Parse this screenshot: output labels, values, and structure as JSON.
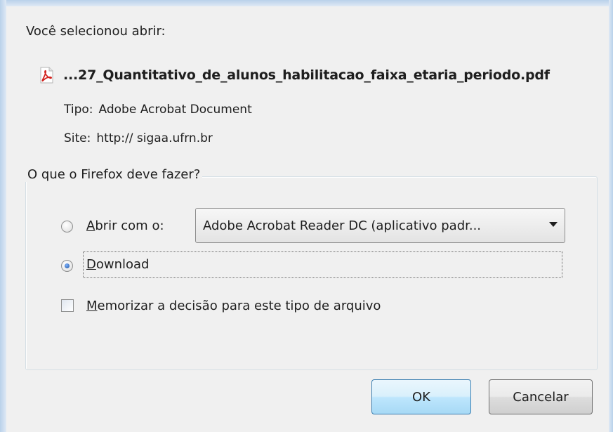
{
  "dialog": {
    "intro": "Você selecionou abrir:",
    "filename": "...27_Quantitativo_de_alunos_habilitacao_faixa_etaria_periodo.pdf",
    "file_icon": "pdf-icon",
    "type_label": "Tipo:",
    "type_value": "Adobe Acrobat Document",
    "site_label": "Site:",
    "site_value": "http:// sigaa.ufrn.br"
  },
  "action_group": {
    "legend": "O que o Firefox deve fazer?",
    "open_with": {
      "label_mnemonic": "A",
      "label_rest": "brir com o:",
      "selected": false,
      "app_select_value": "Adobe Acrobat Reader DC  (aplicativo padr..."
    },
    "download": {
      "label_mnemonic": "D",
      "label_rest": "ownload",
      "selected": true
    },
    "remember": {
      "label_mnemonic": "M",
      "label_rest": "emorizar a decisão para este tipo de arquivo",
      "checked": false
    }
  },
  "buttons": {
    "ok": "OK",
    "cancel": "Cancelar"
  },
  "colors": {
    "ok_border": "#3c7fb1",
    "radio_dot": "#1b4f9c",
    "pdf_red": "#d2231e"
  }
}
